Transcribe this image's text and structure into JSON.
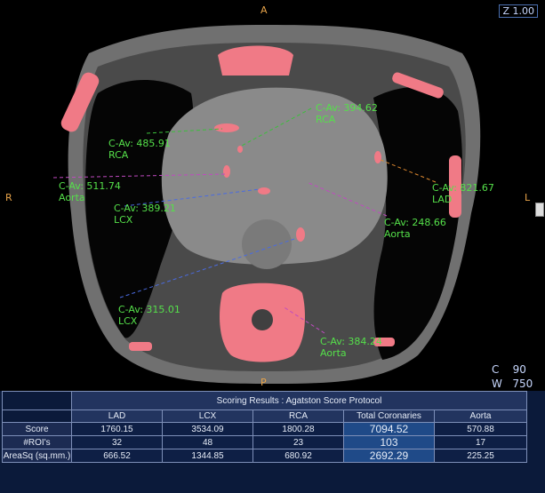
{
  "viewer": {
    "orientation": {
      "top": "A",
      "bottom": "P",
      "left": "R",
      "right": "L"
    },
    "zoom": "Z 1.00",
    "window": {
      "c_label": "C",
      "c_value": "90",
      "w_label": "W",
      "w_value": "750"
    }
  },
  "annotations": [
    {
      "value": "C-Av: 394.62",
      "vessel": "RCA"
    },
    {
      "value": "C-Av: 485.91",
      "vessel": "RCA"
    },
    {
      "value": "C-Av: 511.74",
      "vessel": "Aorta"
    },
    {
      "value": "C-Av: 389.21",
      "vessel": "LCX"
    },
    {
      "value": "C-Av: 821.67",
      "vessel": "LAD"
    },
    {
      "value": "C-Av: 248.66",
      "vessel": "Aorta"
    },
    {
      "value": "C-Av: 315.01",
      "vessel": "LCX"
    },
    {
      "value": "C-Av: 384.24",
      "vessel": "Aorta"
    }
  ],
  "results": {
    "title": "Scoring Results : Agatston Score Protocol",
    "columns": [
      "LAD",
      "LCX",
      "RCA",
      "Total Coronaries",
      "Aorta"
    ],
    "rows": [
      {
        "label": "Score",
        "values": [
          "1760.15",
          "3534.09",
          "1800.28",
          "7094.52",
          "570.88"
        ]
      },
      {
        "label": "#ROI's",
        "values": [
          "32",
          "48",
          "23",
          "103",
          "17"
        ]
      },
      {
        "label": "AreaSq (sq.mm.)",
        "values": [
          "666.52",
          "1344.85",
          "680.92",
          "2692.29",
          "225.25"
        ]
      }
    ]
  },
  "colors": {
    "annotation": "#55e04a",
    "orientation": "#e8a44a",
    "calcium": "#f07a86",
    "table_bg": "#0b1a3a"
  }
}
